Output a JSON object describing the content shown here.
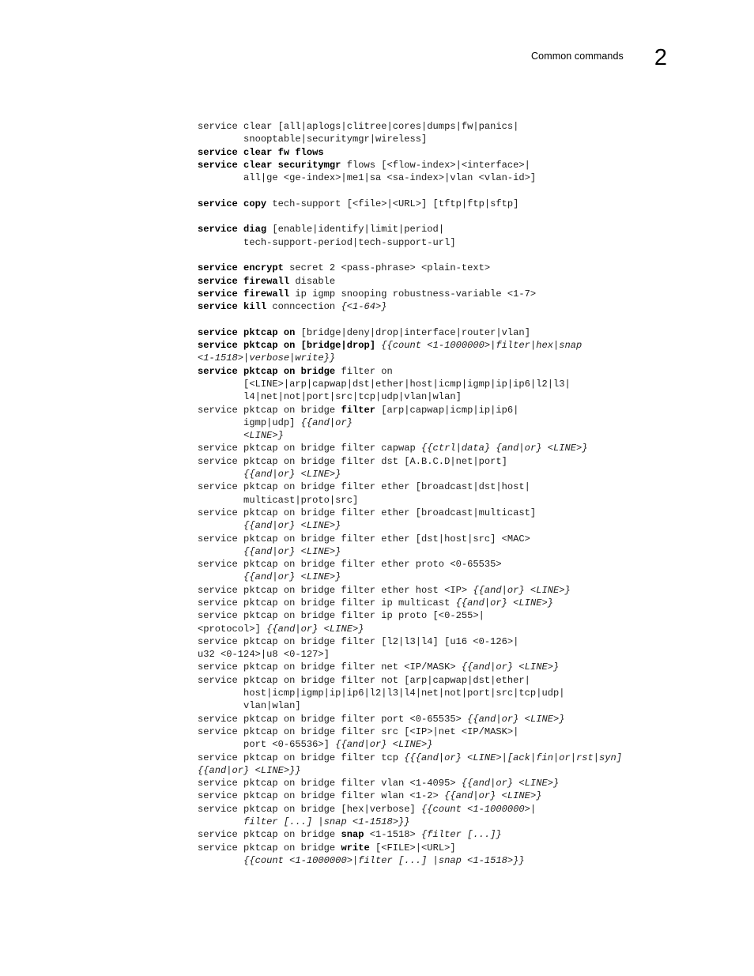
{
  "header": {
    "title": "Common commands",
    "chapter_number": "2"
  },
  "colors": {
    "page_background": "#ffffff",
    "text": "#1b1b1b",
    "bold_text": "#000000"
  },
  "code_block": {
    "lines": [
      {
        "segments": [
          {
            "style": "plain",
            "text": "service clear [all|aplogs|clitree|cores|dumps|fw|panics|"
          }
        ]
      },
      {
        "segments": [
          {
            "style": "plain",
            "text": "        snooptable|securitymgr|wireless]"
          }
        ]
      },
      {
        "segments": [
          {
            "style": "bold",
            "text": "service clear fw flows"
          }
        ]
      },
      {
        "segments": [
          {
            "style": "bold",
            "text": "service clear securitymgr"
          },
          {
            "style": "plain",
            "text": " flows [<flow-index>|<interface>|"
          }
        ]
      },
      {
        "segments": [
          {
            "style": "plain",
            "text": "        all|ge <ge-index>|me1|sa <sa-index>|vlan <vlan-id>]"
          }
        ]
      },
      {
        "segments": [],
        "blank": true
      },
      {
        "segments": [
          {
            "style": "bold",
            "text": "service copy"
          },
          {
            "style": "plain",
            "text": " tech-support [<file>|<URL>] [tftp|ftp|sftp]"
          }
        ]
      },
      {
        "segments": [],
        "blank": true
      },
      {
        "segments": [
          {
            "style": "bold",
            "text": "service diag"
          },
          {
            "style": "plain",
            "text": " [enable|identify|limit|period|"
          }
        ]
      },
      {
        "segments": [
          {
            "style": "plain",
            "text": "        tech-support-period|tech-support-url]"
          }
        ]
      },
      {
        "segments": [],
        "blank": true
      },
      {
        "segments": [
          {
            "style": "bold",
            "text": "service encrypt"
          },
          {
            "style": "plain",
            "text": " secret 2 <pass-phrase> <plain-text>"
          }
        ]
      },
      {
        "segments": [
          {
            "style": "bold",
            "text": "service firewall"
          },
          {
            "style": "plain",
            "text": " disable"
          }
        ]
      },
      {
        "segments": [
          {
            "style": "bold",
            "text": "service firewall"
          },
          {
            "style": "plain",
            "text": " ip igmp snooping robustness-variable <1-7>"
          }
        ]
      },
      {
        "segments": [
          {
            "style": "bold",
            "text": "service kill"
          },
          {
            "style": "plain",
            "text": " conncection "
          },
          {
            "style": "italic",
            "text": "{<1-64>}"
          }
        ]
      },
      {
        "segments": [],
        "blank": true
      },
      {
        "segments": [
          {
            "style": "bold",
            "text": "service pktcap on"
          },
          {
            "style": "plain",
            "text": " [bridge|deny|drop|interface|router|vlan]"
          }
        ]
      },
      {
        "segments": [
          {
            "style": "bold",
            "text": "service pktcap on [bridge|drop]"
          },
          {
            "style": "plain",
            "text": " "
          },
          {
            "style": "italic",
            "text": "{{count <1-1000000>|filter|hex|snap"
          }
        ]
      },
      {
        "segments": [
          {
            "style": "italic",
            "text": "<1-1518>|verbose|write}}"
          }
        ]
      },
      {
        "segments": [
          {
            "style": "bold",
            "text": "service pktcap on bridge"
          },
          {
            "style": "plain",
            "text": " filter on"
          }
        ]
      },
      {
        "segments": [
          {
            "style": "plain",
            "text": "        [<LINE>|arp|capwap|dst|ether|host|icmp|igmp|ip|ip6|l2|l3|"
          }
        ]
      },
      {
        "segments": [
          {
            "style": "plain",
            "text": "        l4|net|not|port|src|tcp|udp|vlan|wlan]"
          }
        ]
      },
      {
        "segments": [
          {
            "style": "plain",
            "text": "service pktcap on bridge "
          },
          {
            "style": "bold",
            "text": "filter"
          },
          {
            "style": "plain",
            "text": " [arp|capwap|icmp|ip|ip6|"
          }
        ]
      },
      {
        "segments": [
          {
            "style": "plain",
            "text": "        igmp|udp] "
          },
          {
            "style": "italic",
            "text": "{{and|or}"
          }
        ]
      },
      {
        "segments": [
          {
            "style": "plain",
            "text": "        "
          },
          {
            "style": "italic",
            "text": "<LINE>}"
          }
        ]
      },
      {
        "segments": [
          {
            "style": "plain",
            "text": "service pktcap on bridge filter capwap "
          },
          {
            "style": "italic",
            "text": "{{ctrl|data} {and|or} <LINE>}"
          }
        ]
      },
      {
        "segments": [
          {
            "style": "plain",
            "text": "service pktcap on bridge filter dst [A.B.C.D|net|port]"
          }
        ]
      },
      {
        "segments": [
          {
            "style": "plain",
            "text": "        "
          },
          {
            "style": "italic",
            "text": "{{and|or} <LINE>}"
          }
        ]
      },
      {
        "segments": [
          {
            "style": "plain",
            "text": "service pktcap on bridge filter ether [broadcast|dst|host|"
          }
        ]
      },
      {
        "segments": [
          {
            "style": "plain",
            "text": "        multicast|proto|src]"
          }
        ]
      },
      {
        "segments": [
          {
            "style": "plain",
            "text": "service pktcap on bridge filter ether [broadcast|multicast]"
          }
        ]
      },
      {
        "segments": [
          {
            "style": "plain",
            "text": "        "
          },
          {
            "style": "italic",
            "text": "{{and|or} <LINE>}"
          }
        ]
      },
      {
        "segments": [
          {
            "style": "plain",
            "text": "service pktcap on bridge filter ether [dst|host|src] <MAC>"
          }
        ]
      },
      {
        "segments": [
          {
            "style": "plain",
            "text": "        "
          },
          {
            "style": "italic",
            "text": "{{and|or} <LINE>}"
          }
        ]
      },
      {
        "segments": [
          {
            "style": "plain",
            "text": "service pktcap on bridge filter ether proto <0-65535>"
          }
        ]
      },
      {
        "segments": [
          {
            "style": "plain",
            "text": "        "
          },
          {
            "style": "italic",
            "text": "{{and|or} <LINE>}"
          }
        ]
      },
      {
        "segments": [
          {
            "style": "plain",
            "text": "service pktcap on bridge filter ether host <IP> "
          },
          {
            "style": "italic",
            "text": "{{and|or} <LINE>}"
          }
        ]
      },
      {
        "segments": [
          {
            "style": "plain",
            "text": "service pktcap on bridge filter ip multicast "
          },
          {
            "style": "italic",
            "text": "{{and|or} <LINE>}"
          }
        ]
      },
      {
        "segments": [
          {
            "style": "plain",
            "text": "service pktcap on bridge filter ip proto [<0-255>|"
          }
        ]
      },
      {
        "segments": [
          {
            "style": "plain",
            "text": "<protocol>] "
          },
          {
            "style": "italic",
            "text": "{{and|or} <LINE>}"
          }
        ]
      },
      {
        "segments": [
          {
            "style": "plain",
            "text": "service pktcap on bridge filter [l2|l3|l4] [u16 <0-126>|"
          }
        ]
      },
      {
        "segments": [
          {
            "style": "plain",
            "text": "u32 <0-124>|u8 <0-127>]"
          }
        ]
      },
      {
        "segments": [
          {
            "style": "plain",
            "text": "service pktcap on bridge filter net <IP/MASK> "
          },
          {
            "style": "italic",
            "text": "{{and|or} <LINE>}"
          }
        ]
      },
      {
        "segments": [
          {
            "style": "plain",
            "text": "service pktcap on bridge filter not [arp|capwap|dst|ether|"
          }
        ]
      },
      {
        "segments": [
          {
            "style": "plain",
            "text": "        host|icmp|igmp|ip|ip6|l2|l3|l4|net|not|port|src|tcp|udp|"
          }
        ]
      },
      {
        "segments": [
          {
            "style": "plain",
            "text": "        vlan|wlan]"
          }
        ]
      },
      {
        "segments": [
          {
            "style": "plain",
            "text": "service pktcap on bridge filter port <0-65535> "
          },
          {
            "style": "italic",
            "text": "{{and|or} <LINE>}"
          }
        ]
      },
      {
        "segments": [
          {
            "style": "plain",
            "text": "service pktcap on bridge filter src [<IP>|net <IP/MASK>|"
          }
        ]
      },
      {
        "segments": [
          {
            "style": "plain",
            "text": "        port <0-65536>] "
          },
          {
            "style": "italic",
            "text": "{{and|or} <LINE>}"
          }
        ]
      },
      {
        "segments": [
          {
            "style": "plain",
            "text": "service pktcap on bridge filter tcp "
          },
          {
            "style": "italic",
            "text": "{{{and|or} <LINE>|[ack|fin|or|rst|syn]"
          }
        ]
      },
      {
        "segments": [
          {
            "style": "italic",
            "text": "{{and|or} <LINE>}}"
          }
        ]
      },
      {
        "segments": [
          {
            "style": "plain",
            "text": "service pktcap on bridge filter vlan <1-4095> "
          },
          {
            "style": "italic",
            "text": "{{and|or} <LINE>}"
          }
        ]
      },
      {
        "segments": [
          {
            "style": "plain",
            "text": "service pktcap on bridge filter wlan <1-2> "
          },
          {
            "style": "italic",
            "text": "{{and|or} <LINE>}"
          }
        ]
      },
      {
        "segments": [
          {
            "style": "plain",
            "text": "service pktcap on bridge [hex|verbose] "
          },
          {
            "style": "italic",
            "text": "{{count <1-1000000>|"
          }
        ]
      },
      {
        "segments": [
          {
            "style": "plain",
            "text": "        "
          },
          {
            "style": "italic",
            "text": "filter [...] |snap <1-1518>}}"
          }
        ]
      },
      {
        "segments": [
          {
            "style": "plain",
            "text": "service pktcap on bridge "
          },
          {
            "style": "bold",
            "text": "snap"
          },
          {
            "style": "plain",
            "text": " <1-1518> "
          },
          {
            "style": "italic",
            "text": "{filter [...]}"
          }
        ]
      },
      {
        "segments": [
          {
            "style": "plain",
            "text": "service pktcap on bridge "
          },
          {
            "style": "bold",
            "text": "write"
          },
          {
            "style": "plain",
            "text": " [<FILE>|<URL>]"
          }
        ]
      },
      {
        "segments": [
          {
            "style": "plain",
            "text": "        "
          },
          {
            "style": "italic",
            "text": "{{count <1-1000000>|filter [...] |snap <1-1518>}}"
          }
        ]
      }
    ]
  }
}
